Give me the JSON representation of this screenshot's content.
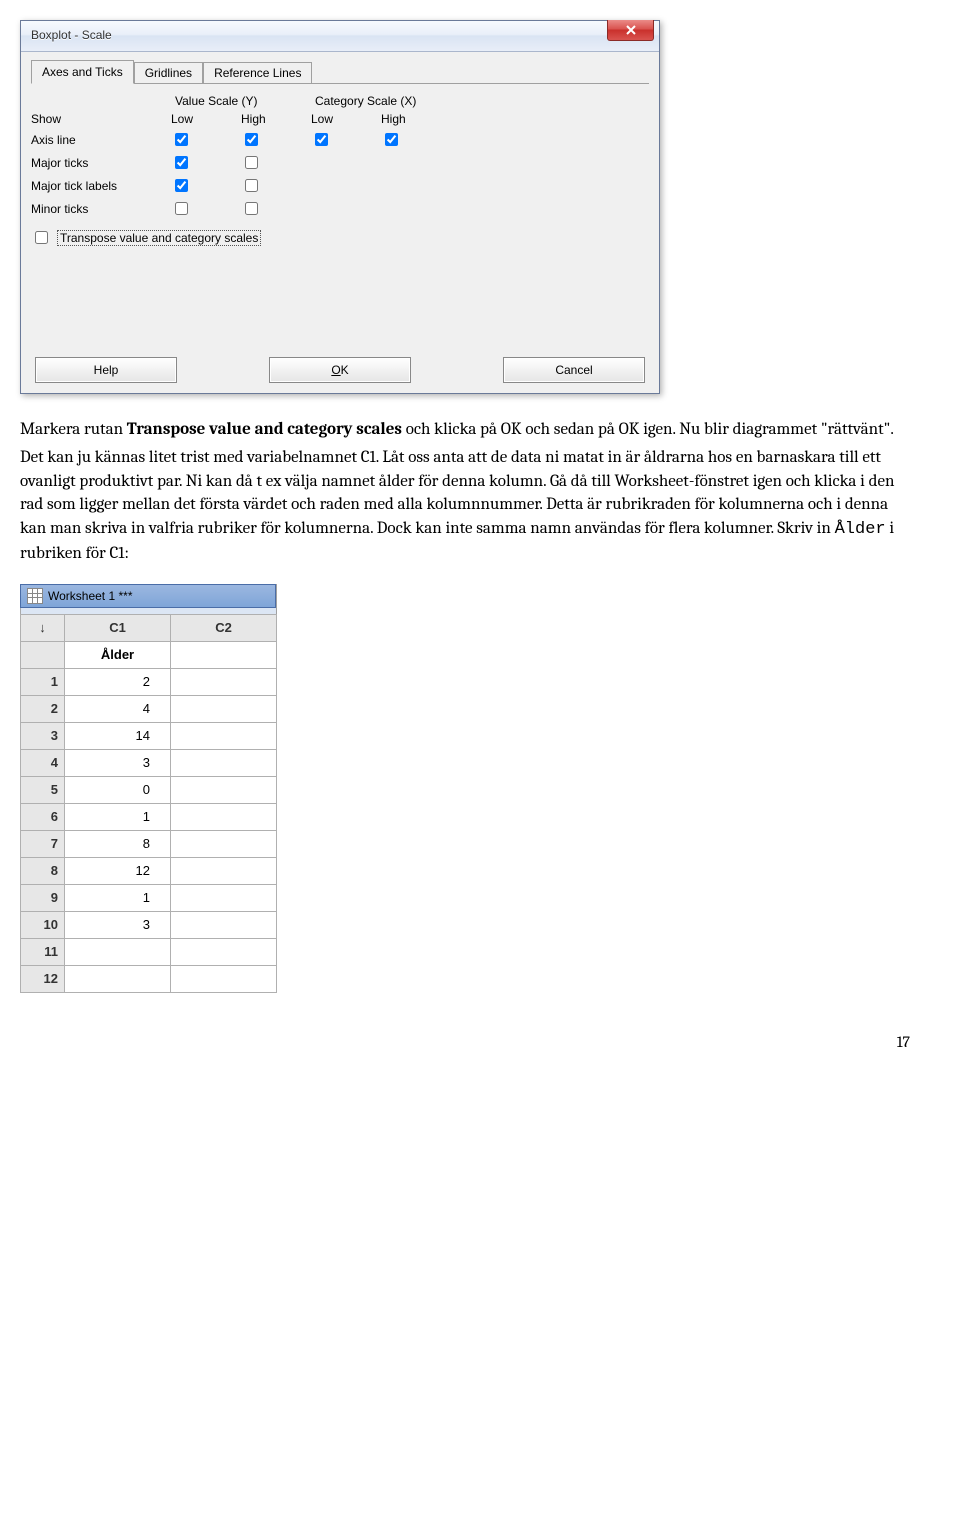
{
  "dialog": {
    "title": "Boxplot - Scale",
    "tabs": [
      "Axes and Ticks",
      "Gridlines",
      "Reference Lines"
    ],
    "col_group1": "Value Scale (Y)",
    "col_group2": "Category Scale (X)",
    "cols": {
      "show": "Show",
      "low": "Low",
      "high": "High"
    },
    "rows": {
      "axis_line": "Axis line",
      "major_ticks": "Major ticks",
      "major_labels": "Major tick labels",
      "minor_ticks": "Minor ticks"
    },
    "transpose_label": "Transpose value and category scales",
    "buttons": {
      "help": "Help",
      "ok": "OK",
      "ok_ul": "O",
      "ok_rest": "K",
      "cancel": "Cancel"
    }
  },
  "text": {
    "p1a": "Markera rutan ",
    "p1b": "Transpose value and category scales",
    "p1c": " och klicka på OK och sedan på OK igen. Nu blir diagrammet \"rättvänt\".",
    "p2": "Det kan ju kännas litet trist med variabelnamnet C1. Låt oss anta att de data ni matat in är åldrarna hos en barnaskara till ett ovanligt produktivt par. Ni kan då t ex välja namnet ålder för denna kolumn. Gå då till Worksheet-fönstret igen och klicka i den rad som ligger mellan det första värdet och raden med alla kolumnnummer. Detta är rubrikraden för kolumnerna och i denna kan man skriva in valfria rubriker för kolumnerna. Dock kan inte samma namn användas för flera kolumner. Skriv in ",
    "p2code": "Ålder",
    "p2end": " i rubriken för C1:"
  },
  "worksheet": {
    "title": "Worksheet 1 ***",
    "arrow": "↓",
    "cols": [
      "C1",
      "C2"
    ],
    "name": "Ålder",
    "rows": [
      {
        "n": "1",
        "v": "2"
      },
      {
        "n": "2",
        "v": "4"
      },
      {
        "n": "3",
        "v": "14"
      },
      {
        "n": "4",
        "v": "3"
      },
      {
        "n": "5",
        "v": "0"
      },
      {
        "n": "6",
        "v": "1"
      },
      {
        "n": "7",
        "v": "8"
      },
      {
        "n": "8",
        "v": "12"
      },
      {
        "n": "9",
        "v": "1"
      },
      {
        "n": "10",
        "v": "3"
      },
      {
        "n": "11",
        "v": ""
      },
      {
        "n": "12",
        "v": ""
      }
    ]
  },
  "page_number": "17"
}
